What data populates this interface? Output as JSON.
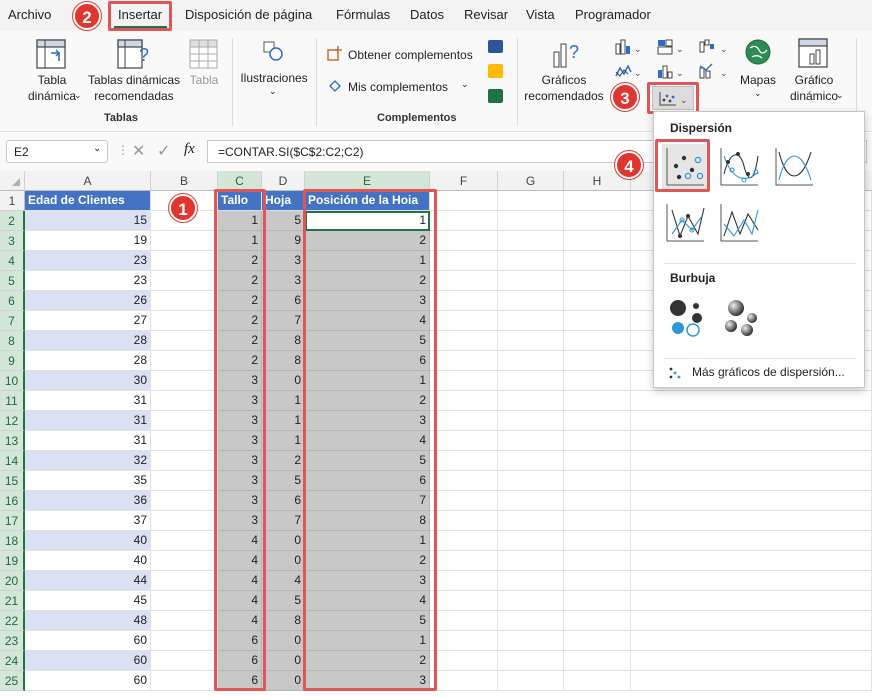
{
  "menu": {
    "items": [
      "Archivo",
      "Inicio",
      "Insertar",
      "Disposición de página",
      "Fórmulas",
      "Datos",
      "Revisar",
      "Vista",
      "Programador"
    ],
    "active": "Insertar"
  },
  "ribbon": {
    "tablas": {
      "pivot_line1": "Tabla",
      "pivot_line2": "dinámica",
      "recommended_line1": "Tablas dinámicas",
      "recommended_line2": "recomendadas",
      "table": "Tabla",
      "group": "Tablas"
    },
    "ilustraciones": {
      "label": "Ilustraciones"
    },
    "complementos": {
      "get": "Obtener complementos",
      "mine": "Mis complementos",
      "group": "Complementos"
    },
    "graficos": {
      "recommended_line1": "Gráficos",
      "recommended_line2": "recomendados",
      "maps": "Mapas",
      "pivotchart_line1": "Gráfico",
      "pivotchart_line2": "dinámico"
    }
  },
  "formula_bar": {
    "name_box": "E2",
    "fx": "fx",
    "formula": "=CONTAR.SI($C$2:C2;C2)"
  },
  "sheet": {
    "columns": [
      "A",
      "B",
      "C",
      "D",
      "E",
      "F",
      "G",
      "H"
    ],
    "headers": {
      "A": "Edad de Clientes",
      "C": "Tallo",
      "D": "Hoja",
      "E": "Posición de la Hoia"
    },
    "rows": [
      {
        "n": "2",
        "a": "15",
        "c": "1",
        "d": "5",
        "e": "1"
      },
      {
        "n": "3",
        "a": "19",
        "c": "1",
        "d": "9",
        "e": "2"
      },
      {
        "n": "4",
        "a": "23",
        "c": "2",
        "d": "3",
        "e": "1"
      },
      {
        "n": "5",
        "a": "23",
        "c": "2",
        "d": "3",
        "e": "2"
      },
      {
        "n": "6",
        "a": "26",
        "c": "2",
        "d": "6",
        "e": "3"
      },
      {
        "n": "7",
        "a": "27",
        "c": "2",
        "d": "7",
        "e": "4"
      },
      {
        "n": "8",
        "a": "28",
        "c": "2",
        "d": "8",
        "e": "5"
      },
      {
        "n": "9",
        "a": "28",
        "c": "2",
        "d": "8",
        "e": "6"
      },
      {
        "n": "10",
        "a": "30",
        "c": "3",
        "d": "0",
        "e": "1"
      },
      {
        "n": "11",
        "a": "31",
        "c": "3",
        "d": "1",
        "e": "2"
      },
      {
        "n": "12",
        "a": "31",
        "c": "3",
        "d": "1",
        "e": "3"
      },
      {
        "n": "13",
        "a": "31",
        "c": "3",
        "d": "1",
        "e": "4"
      },
      {
        "n": "14",
        "a": "32",
        "c": "3",
        "d": "2",
        "e": "5"
      },
      {
        "n": "15",
        "a": "35",
        "c": "3",
        "d": "5",
        "e": "6"
      },
      {
        "n": "16",
        "a": "36",
        "c": "3",
        "d": "6",
        "e": "7"
      },
      {
        "n": "17",
        "a": "37",
        "c": "3",
        "d": "7",
        "e": "8"
      },
      {
        "n": "18",
        "a": "40",
        "c": "4",
        "d": "0",
        "e": "1"
      },
      {
        "n": "19",
        "a": "40",
        "c": "4",
        "d": "0",
        "e": "2"
      },
      {
        "n": "20",
        "a": "44",
        "c": "4",
        "d": "4",
        "e": "3"
      },
      {
        "n": "21",
        "a": "45",
        "c": "4",
        "d": "5",
        "e": "4"
      },
      {
        "n": "22",
        "a": "48",
        "c": "4",
        "d": "8",
        "e": "5"
      },
      {
        "n": "23",
        "a": "60",
        "c": "6",
        "d": "0",
        "e": "1"
      },
      {
        "n": "24",
        "a": "60",
        "c": "6",
        "d": "0",
        "e": "2"
      },
      {
        "n": "25",
        "a": "60",
        "c": "6",
        "d": "0",
        "e": "3"
      }
    ]
  },
  "dropdown": {
    "section_scatter": "Dispersión",
    "section_bubble": "Burbuja",
    "more": "Más gráficos de dispersión..."
  },
  "callouts": [
    "1",
    "2",
    "3",
    "4"
  ],
  "colors": {
    "header_fill": "#4472c4",
    "band_fill": "#d9e1f2",
    "selection_fill": "#c8c8c8",
    "callout_red": "#e2352f",
    "excel_green": "#217346"
  }
}
